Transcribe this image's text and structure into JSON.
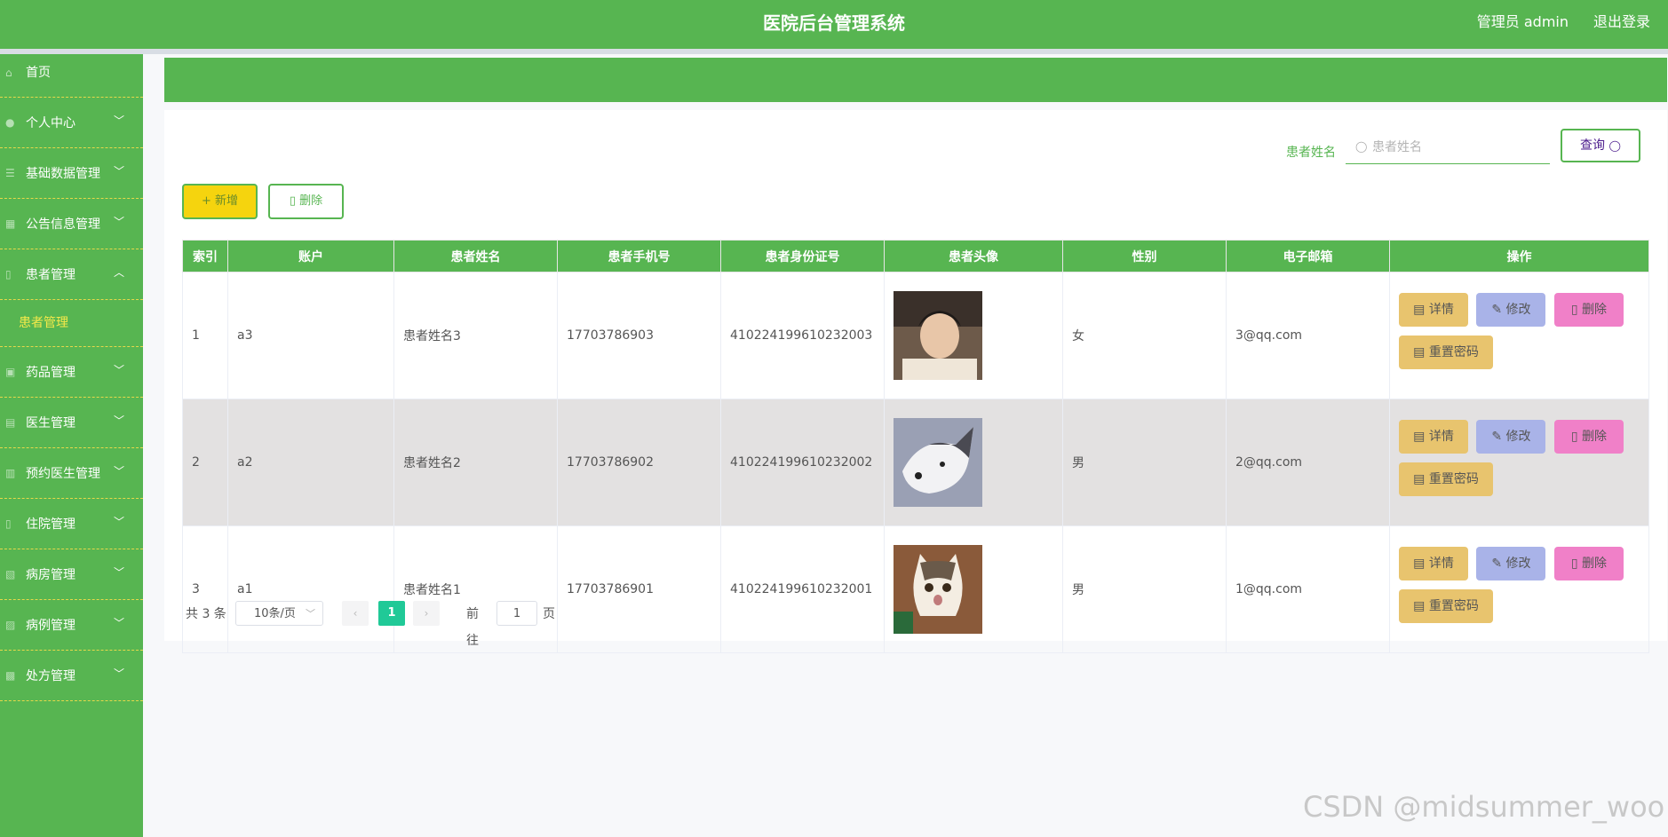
{
  "header": {
    "title": "医院后台管理系统",
    "user": "管理员 admin",
    "logout": "退出登录"
  },
  "sidebar": {
    "items": [
      {
        "label": "首页",
        "icon": "home-icon"
      },
      {
        "label": "个人中心",
        "icon": "user-icon"
      },
      {
        "label": "基础数据管理",
        "icon": "list-icon"
      },
      {
        "label": "公告信息管理",
        "icon": "notice-icon"
      },
      {
        "label": "患者管理",
        "icon": "patient-icon",
        "expanded": true,
        "children": [
          {
            "label": "患者管理"
          }
        ]
      },
      {
        "label": "药品管理",
        "icon": "medicine-icon"
      },
      {
        "label": "医生管理",
        "icon": "doctor-icon"
      },
      {
        "label": "预约医生管理",
        "icon": "calendar-icon"
      },
      {
        "label": "住院管理",
        "icon": "bed-icon"
      },
      {
        "label": "病房管理",
        "icon": "ward-icon"
      },
      {
        "label": "病例管理",
        "icon": "case-icon"
      },
      {
        "label": "处方管理",
        "icon": "prescription-icon"
      }
    ]
  },
  "search": {
    "label": "患者姓名",
    "placeholder": "患者姓名",
    "button": "查询"
  },
  "actions": {
    "add": "新增",
    "delete": "删除"
  },
  "table": {
    "headers": [
      "索引",
      "账户",
      "患者姓名",
      "患者手机号",
      "患者身份证号",
      "患者头像",
      "性别",
      "电子邮箱",
      "操作"
    ],
    "rows": [
      {
        "index": "1",
        "account": "a3",
        "name": "患者姓名3",
        "phone": "17703786903",
        "idcard": "410224199610232003",
        "avatar": "young-man-photo",
        "gender": "女",
        "email": "3@qq.com"
      },
      {
        "index": "2",
        "account": "a2",
        "name": "患者姓名2",
        "phone": "17703786902",
        "idcard": "410224199610232002",
        "avatar": "husky-dog-photo",
        "gender": "男",
        "email": "2@qq.com"
      },
      {
        "index": "3",
        "account": "a1",
        "name": "患者姓名1",
        "phone": "17703786901",
        "idcard": "410224199610232001",
        "avatar": "cat-photo",
        "gender": "男",
        "email": "1@qq.com"
      }
    ],
    "ops": {
      "detail": "详情",
      "edit": "修改",
      "delete": "删除",
      "reset": "重置密码"
    }
  },
  "pagination": {
    "total": "共 3 条",
    "page_size": "10条/页",
    "current": "1",
    "goto_label": "前往",
    "goto_value": "1",
    "page_unit": "页"
  },
  "watermark": "CSDN @midsummer_woo",
  "colors": {
    "primary": "#57b551",
    "accent_yellow": "#f5d40e",
    "pager_active": "#20c997"
  }
}
